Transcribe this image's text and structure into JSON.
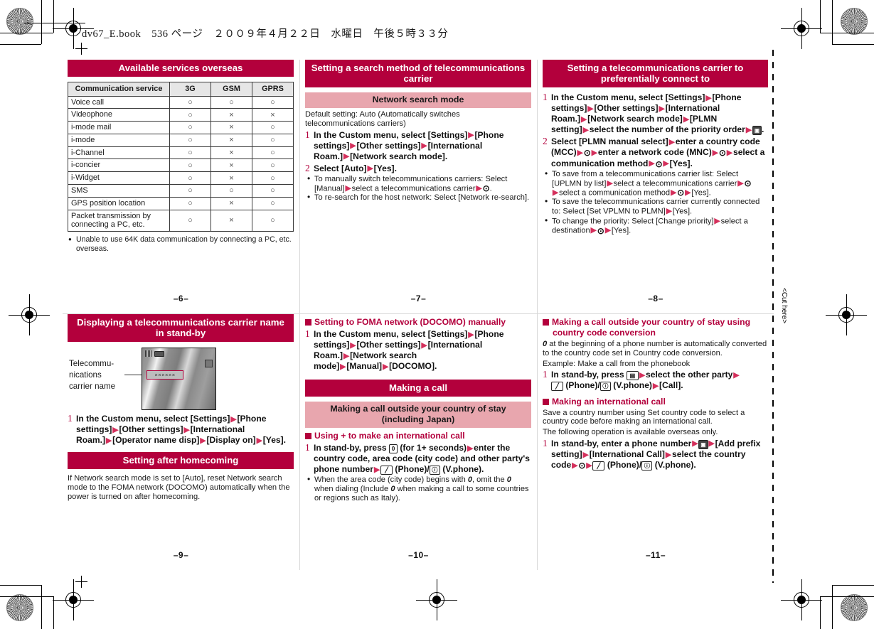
{
  "header": {
    "book_line": "dv67_E.book 536 ページ ２００９年４月２２日　水曜日　午後５時３３分"
  },
  "cut_mark": {
    "label": "<Cut here>"
  },
  "colors": {
    "heading_red": "#b3003c",
    "subheading_pink": "#e8a6ae",
    "arrow": "#d4305c",
    "step_number": "#b3003c"
  },
  "pages": {
    "p6": {
      "folio": "–6–",
      "title": "Available services overseas",
      "table": {
        "headers": [
          "Communication service",
          "3G",
          "GSM",
          "GPRS"
        ],
        "rows": [
          {
            "service": "Voice call",
            "3G": "○",
            "GSM": "○",
            "GPRS": "○"
          },
          {
            "service": "Videophone",
            "3G": "○",
            "GSM": "×",
            "GPRS": "×"
          },
          {
            "service": "i-mode mail",
            "3G": "○",
            "GSM": "×",
            "GPRS": "○"
          },
          {
            "service": "i-mode",
            "3G": "○",
            "GSM": "×",
            "GPRS": "○"
          },
          {
            "service": "i-Channel",
            "3G": "○",
            "GSM": "×",
            "GPRS": "○"
          },
          {
            "service": "i-concier",
            "3G": "○",
            "GSM": "×",
            "GPRS": "○"
          },
          {
            "service": "i-Widget",
            "3G": "○",
            "GSM": "×",
            "GPRS": "○"
          },
          {
            "service": "SMS",
            "3G": "○",
            "GSM": "○",
            "GPRS": "○"
          },
          {
            "service": "GPS position location",
            "3G": "○",
            "GSM": "×",
            "GPRS": "○"
          },
          {
            "service": "Packet transmission by connecting a PC, etc.",
            "3G": "○",
            "GSM": "×",
            "GPRS": "○"
          }
        ]
      },
      "note": "Unable to use 64K data communication by connecting a PC, etc. overseas."
    },
    "p7": {
      "folio": "–7–",
      "title": "Setting a search method of telecommunications carrier",
      "subheading": "Network search mode",
      "default_setting": "Default setting: Auto (Automatically switches telecommunications carriers)",
      "step1_num": "1",
      "step1": "In the Custom menu, select [Settings] ▶ [Phone settings] ▶ [Other settings] ▶ [International Roam.] ▶ [Network search mode].",
      "step2_num": "2",
      "step2": "Select [Auto] ▶ [Yes].",
      "bullets": [
        "To manually switch telecommunications carriers: Select [Manual] ▶ select a telecommunications carrier ▶ ⊙.",
        "To re-search for the host network: Select [Network re-search]."
      ]
    },
    "p8": {
      "folio": "–8–",
      "title": "Setting a telecommunications carrier to preferentially connect to",
      "step1_num": "1",
      "step1": "In the Custom menu, select [Settings] ▶ [Phone settings] ▶ [Other settings] ▶ [International Roam.] ▶ [Network search mode] ▶ [PLMN setting] ▶ select the number of the priority order ▶ [camera-key].",
      "step2_num": "2",
      "step2": "Select [PLMN manual select] ▶ enter a country code (MCC) ▶ ⊙ ▶ enter a network code (MNC) ▶ ⊙ ▶ select a communication method ▶ ⊙ ▶ [Yes].",
      "bullets": [
        "To save from a telecommunications carrier list: Select [UPLMN by list] ▶ select a telecommunications carrier ▶ ⊙ ▶ select a communication method ▶ ⊙ ▶ [Yes].",
        "To save the telecommunications carrier currently connected to: Select [Set VPLMN to PLMN] ▶ [Yes].",
        "To change the priority: Select [Change priority] ▶ select a destination ▶ ⊙ ▶ [Yes]."
      ]
    },
    "p9": {
      "folio": "–9–",
      "title": "Displaying a telecommunications carrier name in stand-by",
      "figure_label": "Telecommu-\nnications\ncarrier name",
      "figure_carrier_text": "××××××",
      "step1_num": "1",
      "step1": "In the Custom menu, select [Settings] ▶ [Phone settings] ▶ [Other settings] ▶ [International Roam.] ▶ [Operator name disp] ▶ [Display on] ▶ [Yes].",
      "section2_title": "Setting after homecoming",
      "section2_text": "If Network search mode is set to [Auto], reset Network search mode to the FOMA network (DOCOMO) automatically when the power is turned on after homecoming."
    },
    "p10": {
      "folio": "–10–",
      "sq1_title": "Setting to FOMA network (DOCOMO) manually",
      "sq1_step_num": "1",
      "sq1_step": "In the Custom menu, select [Settings] ▶ [Phone settings] ▶ [Other settings] ▶ [International Roam.] ▶ [Network search mode] ▶ [Manual] ▶ [DOCOMO].",
      "title": "Making a call",
      "subheading": "Making a call outside your country of stay (including Japan)",
      "sq2_title": "Using + to make an international call",
      "sq2_step_num": "1",
      "sq2_step": "In stand-by, press [0] (for 1+ seconds) ▶ enter the country code, area code (city code) and other party's phone number ▶ [talk-key] (Phone)/[i-key] (V.phone).",
      "bullets": [
        "When the area code (city code) begins with 0, omit the 0 when dialing (Include 0 when making a call to some countries or regions such as Italy)."
      ]
    },
    "p11": {
      "folio": "–11–",
      "sq1_title": "Making a call outside your country of stay using country code conversion",
      "sq1_text_a": "0 at the beginning of a phone number is automatically converted to the country code set in Country code conversion.",
      "sq1_text_b": "Example: Make a call from the phonebook",
      "sq1_step_num": "1",
      "sq1_step": "In stand-by, press [phonebook-key] ▶ select the other party ▶ [talk-key] (Phone)/[i-key] (V.phone) ▶ [Call].",
      "sq2_title": "Making an international call",
      "sq2_text_a": "Save a country number using Set country code to select a country code before making an international call.",
      "sq2_text_b": "The following operation is available overseas only.",
      "sq2_step_num": "1",
      "sq2_step": "In stand-by, enter a phone number ▶ [camera-key] ▶ [Add prefix setting] ▶ [International Call] ▶ select the country code ▶ ⊙ ▶ [talk-key] (Phone)/[i-key] (V.phone)."
    }
  }
}
